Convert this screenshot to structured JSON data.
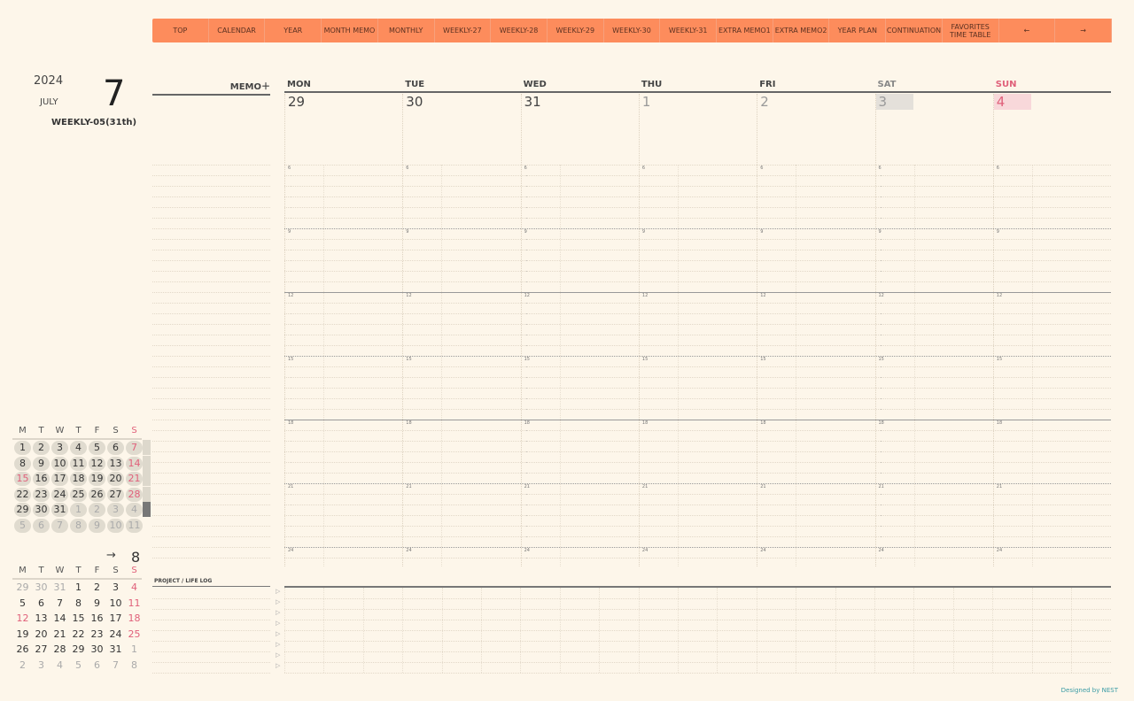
{
  "nav": [
    "TOP",
    "CALENDAR",
    "YEAR",
    "MONTH MEMO",
    "MONTHLY",
    "WEEKLY-27",
    "WEEKLY-28",
    "WEEKLY-29",
    "WEEKLY-30",
    "WEEKLY-31",
    "EXTRA MEMO1",
    "EXTRA MEMO2",
    "YEAR PLAN",
    "CONTINUATION",
    "FAVORITES TIME TABLE",
    "←",
    "→"
  ],
  "header": {
    "year": "2024",
    "month_name": "JULY",
    "month_num": "7",
    "week": "WEEKLY-05(31th)",
    "memo": "MEMO＋"
  },
  "days": [
    {
      "name": "MON",
      "num": "29"
    },
    {
      "name": "TUE",
      "num": "30"
    },
    {
      "name": "WED",
      "num": "31"
    },
    {
      "name": "THU",
      "num": "1"
    },
    {
      "name": "FRI",
      "num": "2"
    },
    {
      "name": "SAT",
      "num": "3"
    },
    {
      "name": "SUN",
      "num": "4"
    }
  ],
  "hours": [
    "6",
    "9",
    "12",
    "15",
    "18",
    "21",
    "24"
  ],
  "mini_headers": [
    "M",
    "T",
    "W",
    "T",
    "F",
    "S",
    "S"
  ],
  "july": [
    [
      "1",
      "2",
      "3",
      "4",
      "5",
      "6",
      "7"
    ],
    [
      "8",
      "9",
      "10",
      "11",
      "12",
      "13",
      "14"
    ],
    [
      "15",
      "16",
      "17",
      "18",
      "19",
      "20",
      "21"
    ],
    [
      "22",
      "23",
      "24",
      "25",
      "26",
      "27",
      "28"
    ],
    [
      "29",
      "30",
      "31",
      "1",
      "2",
      "3",
      "4"
    ],
    [
      "5",
      "6",
      "7",
      "8",
      "9",
      "10",
      "11"
    ]
  ],
  "next_label": "→",
  "next_month": "8",
  "august": [
    [
      "29",
      "30",
      "31",
      "1",
      "2",
      "3",
      "4"
    ],
    [
      "5",
      "6",
      "7",
      "8",
      "9",
      "10",
      "11"
    ],
    [
      "12",
      "13",
      "14",
      "15",
      "16",
      "17",
      "18"
    ],
    [
      "19",
      "20",
      "21",
      "22",
      "23",
      "24",
      "25"
    ],
    [
      "26",
      "27",
      "28",
      "29",
      "30",
      "31",
      "1"
    ],
    [
      "2",
      "3",
      "4",
      "5",
      "6",
      "7",
      "8"
    ]
  ],
  "log_title": "PROJECT / LIFE LOG",
  "footer": "Designed by NEST",
  "colors": {
    "nav": "#fd8c5c",
    "sunday": "#e0607a",
    "sat_bg": "#e4e0da",
    "sun_bg": "#f8d8da"
  }
}
